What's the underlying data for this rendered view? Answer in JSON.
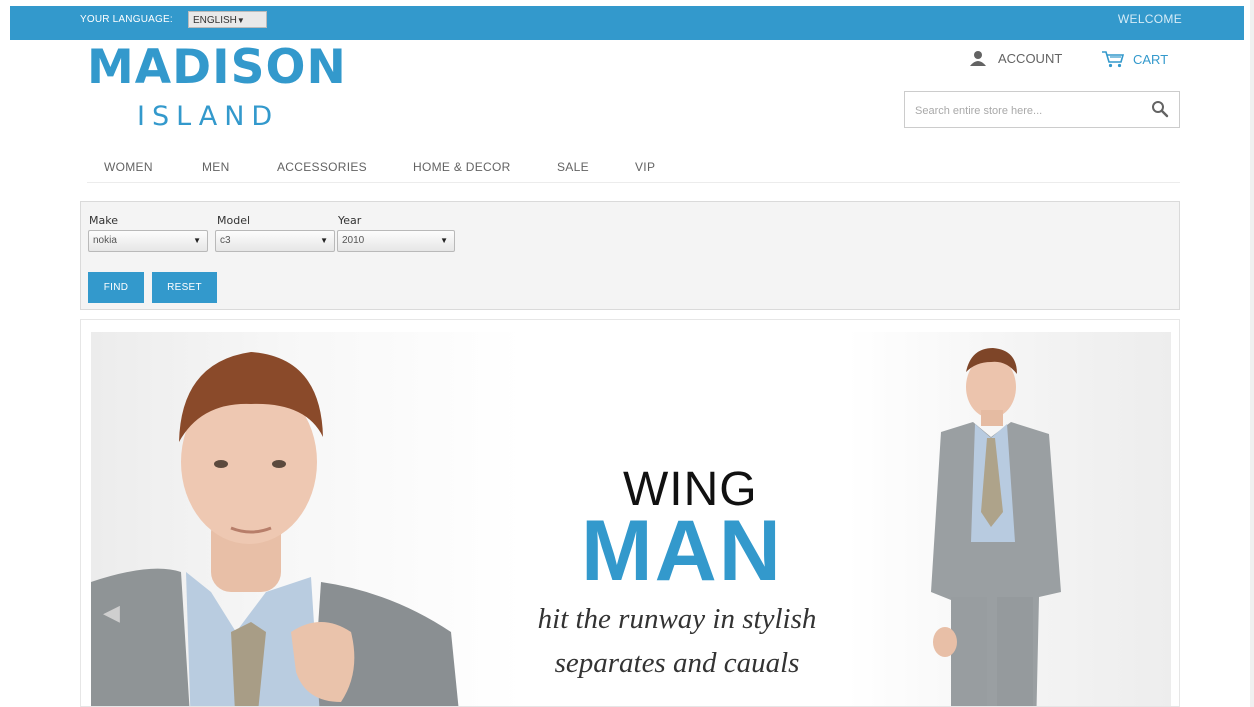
{
  "topbar": {
    "language_label": "YOUR LANGUAGE:",
    "language_value": "ENGLISH",
    "welcome": "WELCOME"
  },
  "logo": {
    "main": "MADISON",
    "sub": "ISLAND"
  },
  "header": {
    "account": "ACCOUNT",
    "cart": "CART",
    "search_placeholder": "Search entire store here..."
  },
  "nav": {
    "items": [
      "WOMEN",
      "MEN",
      "ACCESSORIES",
      "HOME & DECOR",
      "SALE",
      "VIP"
    ]
  },
  "finder": {
    "make_label": "Make",
    "make_value": "nokia",
    "model_label": "Model",
    "model_value": "c3",
    "year_label": "Year",
    "year_value": "2010",
    "find_label": "FIND",
    "reset_label": "RESET"
  },
  "hero": {
    "line1": "WING",
    "line2": "MAN",
    "tagline_1": "hit the runway in stylish",
    "tagline_2": "separates and cauals"
  },
  "colors": {
    "brand": "#3399cc",
    "text": "#636363"
  }
}
